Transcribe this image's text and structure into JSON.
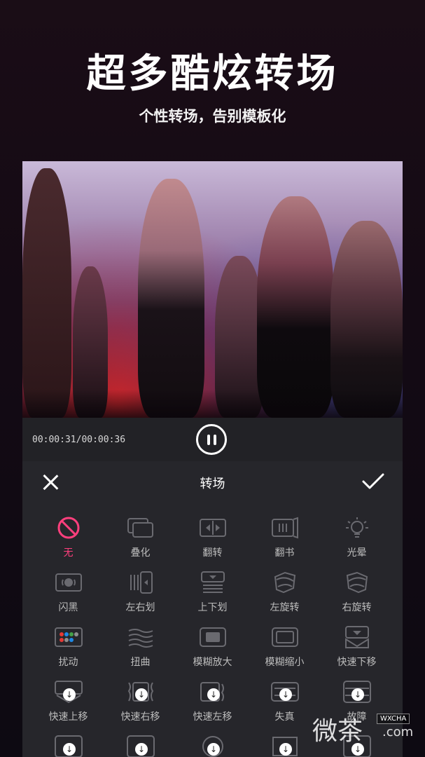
{
  "hero": {
    "title": "超多酷炫转场",
    "subtitle": "个性转场，告别模板化"
  },
  "player": {
    "time": "00:00:31/00:00:36",
    "state": "playing"
  },
  "panel": {
    "title": "转场",
    "accent_color": "#ff3f7d"
  },
  "transitions": [
    {
      "label": "无",
      "icon": "none-icon",
      "active": true
    },
    {
      "label": "叠化",
      "icon": "dissolve-icon"
    },
    {
      "label": "翻转",
      "icon": "flip-icon"
    },
    {
      "label": "翻书",
      "icon": "book-flip-icon"
    },
    {
      "label": "光晕",
      "icon": "glow-icon"
    },
    {
      "label": "闪黑",
      "icon": "flash-black-icon"
    },
    {
      "label": "左右划",
      "icon": "swipe-horizontal-icon"
    },
    {
      "label": "上下划",
      "icon": "swipe-vertical-icon"
    },
    {
      "label": "左旋转",
      "icon": "rotate-left-icon"
    },
    {
      "label": "右旋转",
      "icon": "rotate-right-icon"
    },
    {
      "label": "扰动",
      "icon": "glitch-icon"
    },
    {
      "label": "扭曲",
      "icon": "distort-icon"
    },
    {
      "label": "模糊放大",
      "icon": "blur-zoom-in-icon"
    },
    {
      "label": "模糊缩小",
      "icon": "blur-zoom-out-icon"
    },
    {
      "label": "快速下移",
      "icon": "fast-down-icon"
    },
    {
      "label": "快速上移",
      "icon": "fast-up-icon",
      "download": true
    },
    {
      "label": "快速右移",
      "icon": "fast-right-icon",
      "download": true
    },
    {
      "label": "快速左移",
      "icon": "fast-left-icon",
      "download": true
    },
    {
      "label": "失真",
      "icon": "distortion-icon",
      "download": true
    },
    {
      "label": "故障",
      "icon": "fault-icon",
      "download": true
    }
  ],
  "watermark": {
    "text": "微茶",
    "tag": "WXCHA",
    "domain": ".com"
  }
}
